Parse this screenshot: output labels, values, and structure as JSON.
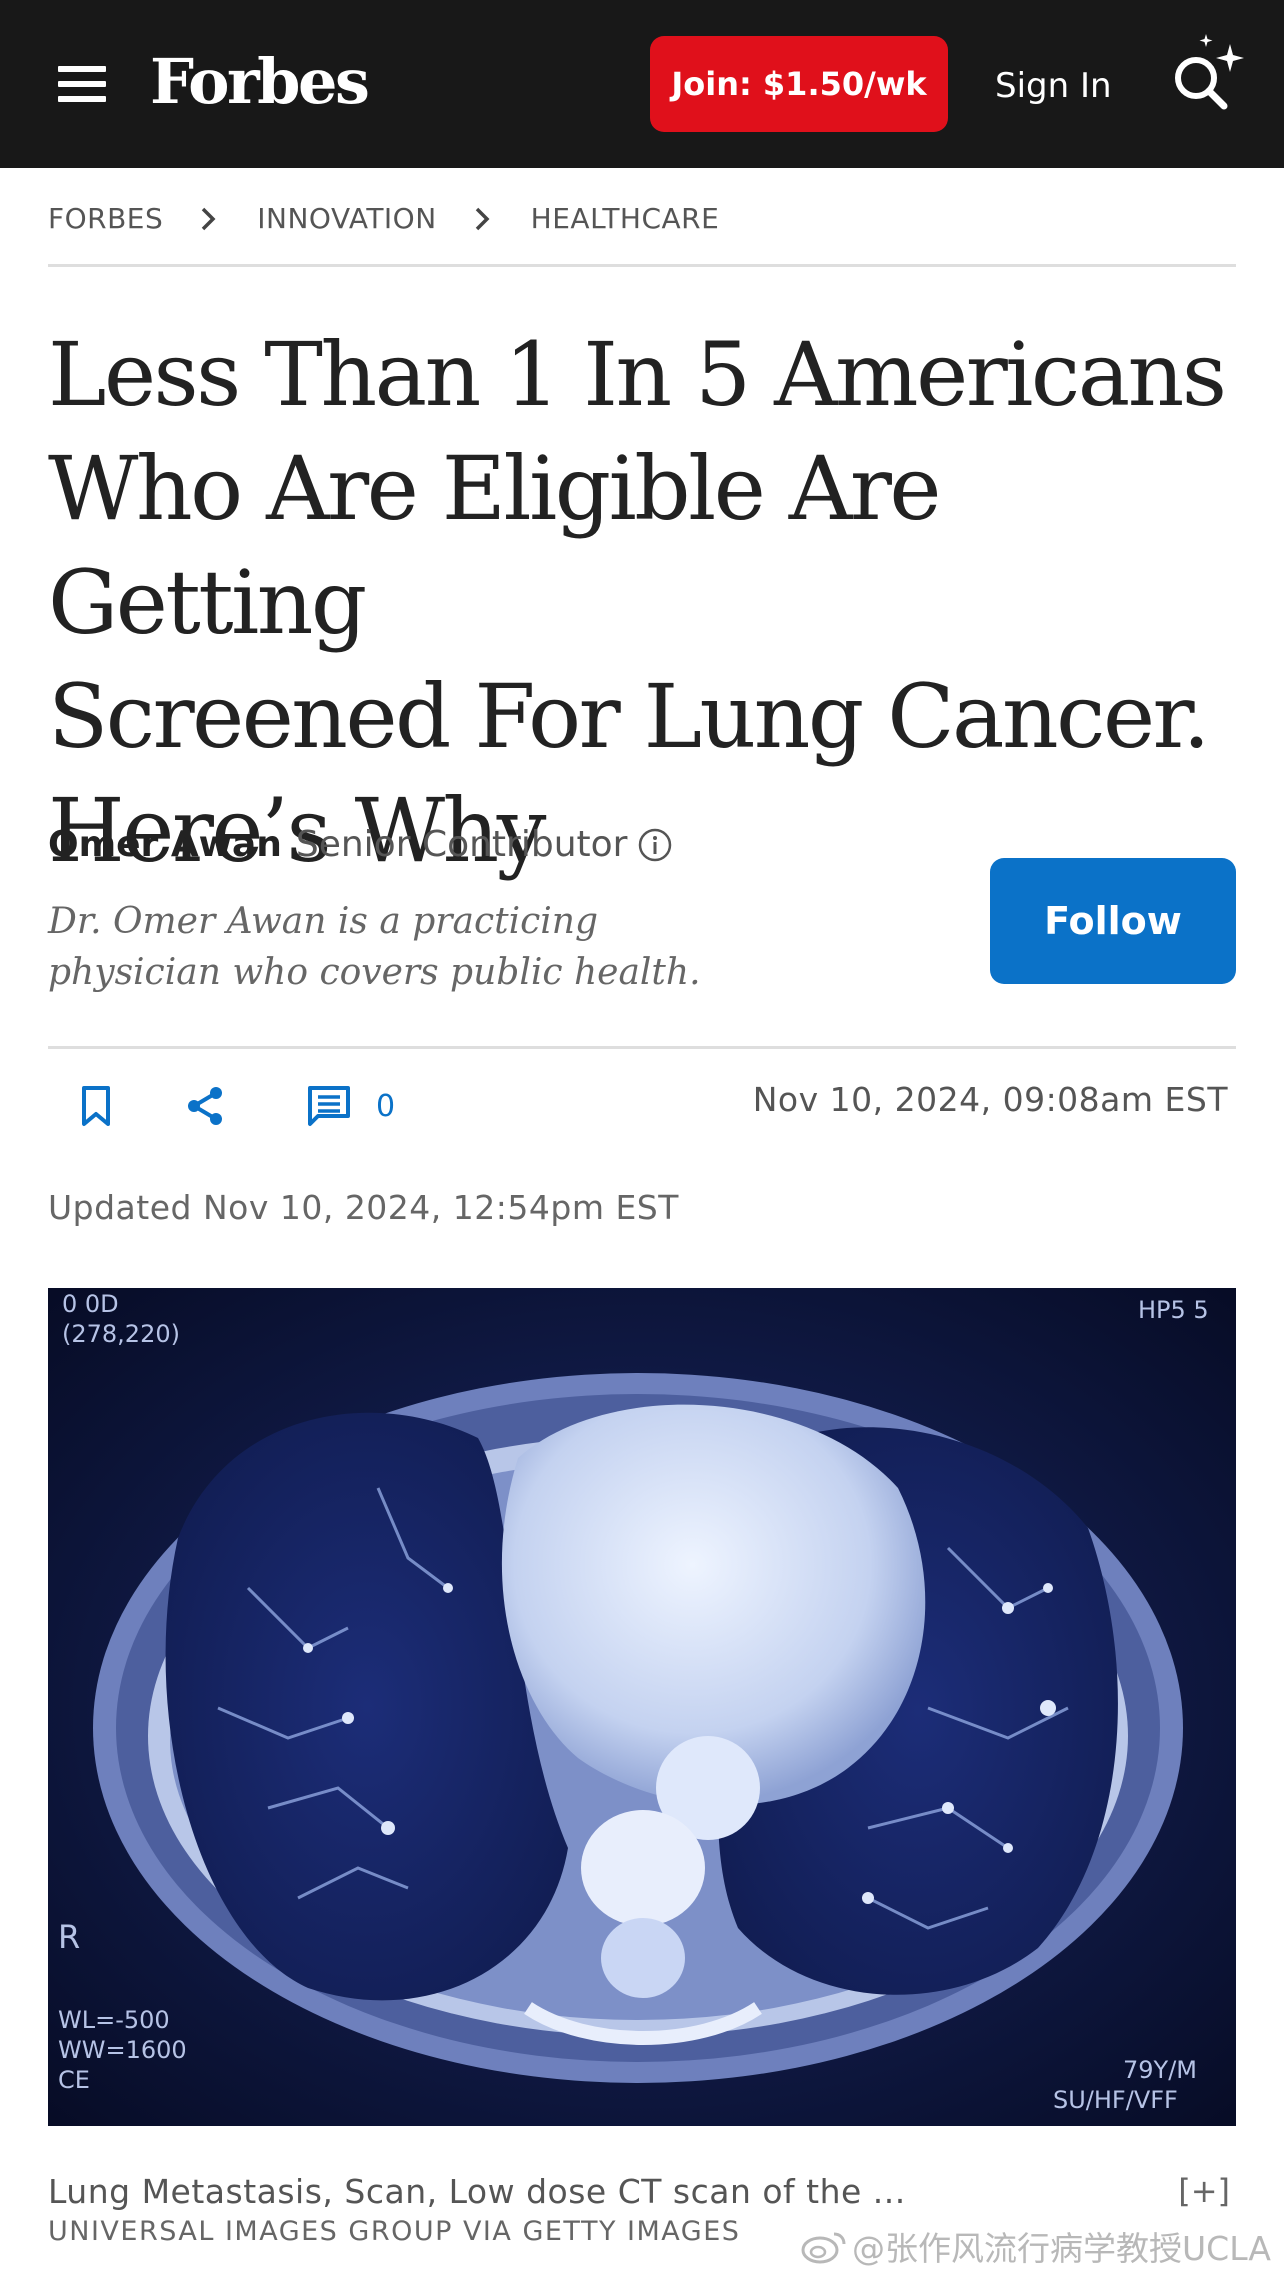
{
  "header": {
    "logo": "Forbes",
    "join_label": "Join: $1.50/wk",
    "signin_label": "Sign In"
  },
  "breadcrumb": [
    "FORBES",
    "INNOVATION",
    "HEALTHCARE"
  ],
  "article": {
    "headline_lines": [
      "Less Than 1 In 5 Americans",
      "Who Are Eligible Are Getting",
      "Screened For Lung Cancer.",
      "Here’s Why"
    ],
    "author": {
      "name": "Omer Awan",
      "role": "Senior Contributor",
      "bio_lines": [
        "Dr. Omer Awan is a practicing",
        "physician who covers public health."
      ],
      "follow_label": "Follow"
    },
    "comment_count": "0",
    "published": "Nov 10, 2024, 09:08am EST",
    "updated": "Updated Nov 10, 2024, 12:54pm EST"
  },
  "hero_image": {
    "overlay": {
      "top_left_1": "0 0D",
      "top_left_2": "(278,220)",
      "top_right": "HP5 5",
      "side_marker": "R",
      "bottom_left_1": "WL=-500",
      "bottom_left_2": "WW=1600",
      "bottom_left_3": "CE",
      "bottom_right_1": "79Y/M",
      "bottom_right_2": "SU/HF/VFF"
    },
    "caption": "Lung Metastasis, Scan, Low dose CT scan of the ...",
    "expand_label": "[+]",
    "credit": "UNIVERSAL IMAGES GROUP VIA GETTY IMAGES"
  },
  "watermark": "@张作风流行病学教授UCLA",
  "colors": {
    "header_bg": "#181818",
    "join_red": "#e0101b",
    "follow_blue": "#0b72c8"
  },
  "icons": [
    "menu-icon",
    "search-sparkle-icon",
    "chevron-right-icon",
    "info-icon",
    "bookmark-icon",
    "share-icon",
    "comment-icon",
    "weibo-icon"
  ]
}
